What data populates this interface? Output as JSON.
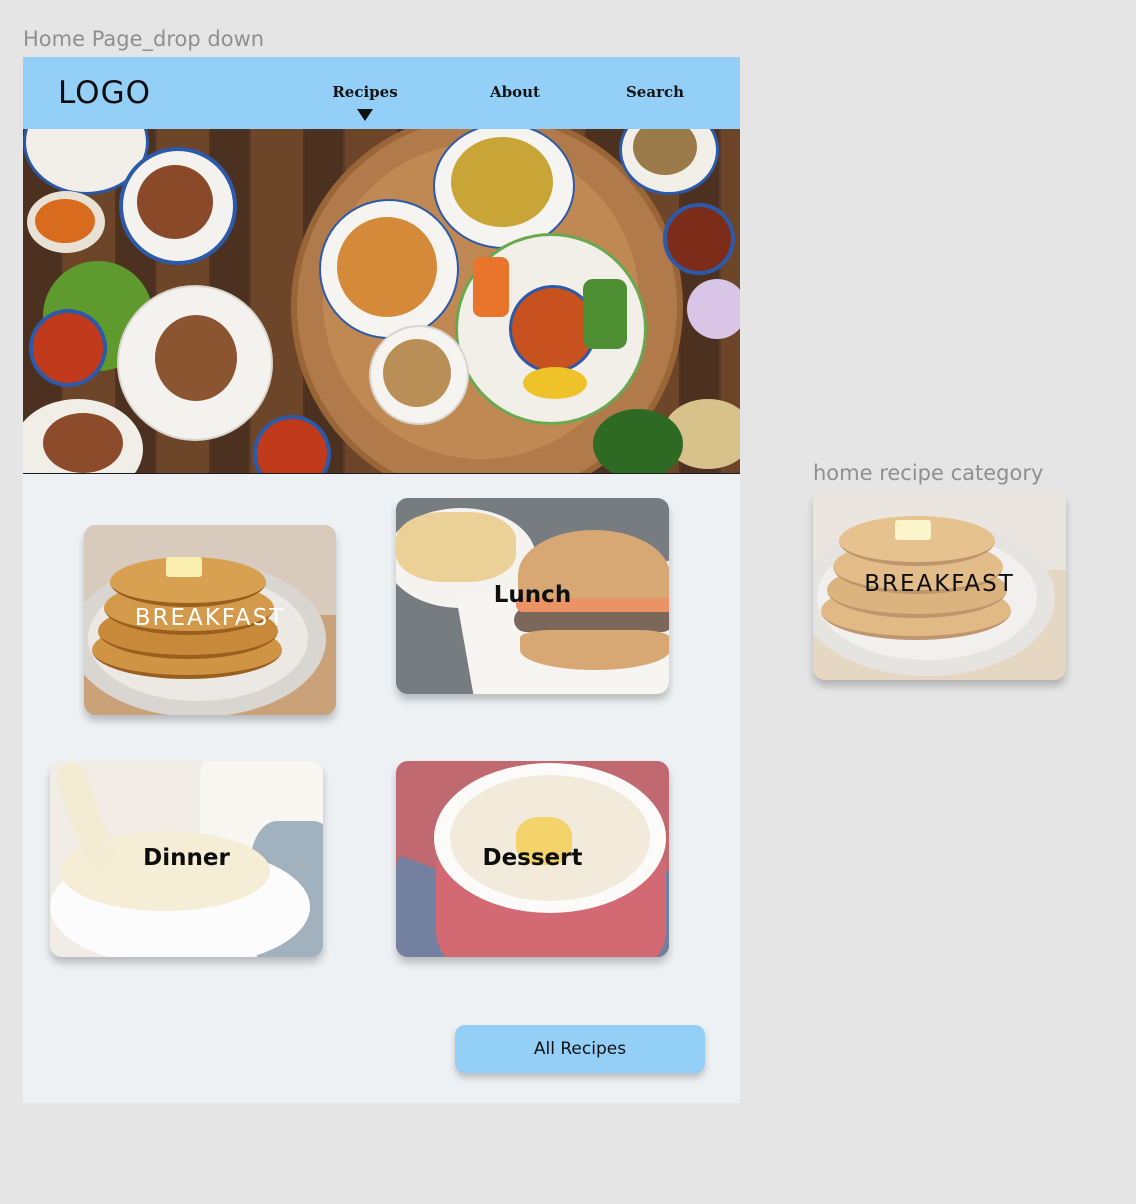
{
  "frames": {
    "main_label": "Home Page_drop down",
    "side_label": "home recipe category"
  },
  "navbar": {
    "logo": "LOGO",
    "links": [
      "Recipes",
      "About",
      "Search"
    ],
    "active_link": "Recipes",
    "dropdown_icon": "triangle-down-icon",
    "background": "#93cff7"
  },
  "hero": {
    "image": "thai-food-spread-photo"
  },
  "categories": [
    {
      "label": "BREAKFAST",
      "image": "pancakes-photo"
    },
    {
      "label": "Lunch",
      "image": "burger-fries-photo"
    },
    {
      "label": "Dinner",
      "image": "pasta-photo"
    },
    {
      "label": "Dessert",
      "image": "tapioca-pudding-photo"
    }
  ],
  "all_recipes_button": "All Recipes",
  "component_preview": {
    "label": "BREAKFAST",
    "image": "pancakes-photo"
  },
  "colors": {
    "canvas": "#e5e5e5",
    "page_background": "#edf1f4",
    "accent": "#93cff7"
  }
}
